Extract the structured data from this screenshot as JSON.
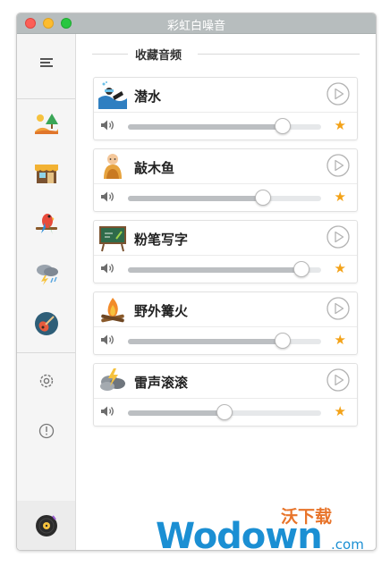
{
  "window": {
    "title": "彩虹白噪音"
  },
  "section": {
    "label": "收藏音频"
  },
  "sidebar": {
    "items": [
      {
        "name": "menu-icon"
      },
      {
        "name": "nature-icon"
      },
      {
        "name": "shop-icon"
      },
      {
        "name": "parrot-icon"
      },
      {
        "name": "storm-icon"
      },
      {
        "name": "guitar-icon"
      },
      {
        "name": "settings-icon"
      },
      {
        "name": "info-icon"
      },
      {
        "name": "vinyl-record-icon"
      }
    ]
  },
  "cards": [
    {
      "name": "潜水",
      "icon": "diving-icon",
      "volume": 0.8,
      "favorite": true
    },
    {
      "name": "敲木鱼",
      "icon": "monk-icon",
      "volume": 0.7,
      "favorite": true
    },
    {
      "name": "粉笔写字",
      "icon": "chalkboard-icon",
      "volume": 0.9,
      "favorite": true
    },
    {
      "name": "野外篝火",
      "icon": "campfire-icon",
      "volume": 0.8,
      "favorite": true
    },
    {
      "name": "雷声滚滚",
      "icon": "thunder-cloud-icon",
      "volume": 0.5,
      "favorite": true
    }
  ],
  "star_symbol": "★",
  "colors": {
    "star": "#f3a218",
    "accent": "#1b8fd3"
  },
  "watermark": {
    "main": "Wodown",
    "suffix": ".com",
    "cn": "沃下载"
  }
}
